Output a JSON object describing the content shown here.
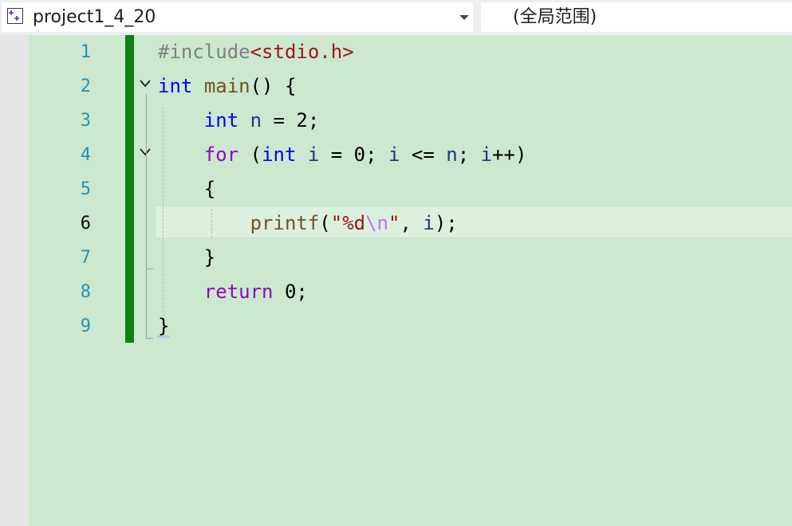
{
  "nav": {
    "project_combo": "project1_4_20",
    "scope_combo": "(全局范围)"
  },
  "editor": {
    "current_line": 6,
    "lines": [
      {
        "num": "1"
      },
      {
        "num": "2"
      },
      {
        "num": "3"
      },
      {
        "num": "4"
      },
      {
        "num": "5"
      },
      {
        "num": "6"
      },
      {
        "num": "7"
      },
      {
        "num": "8"
      },
      {
        "num": "9"
      }
    ],
    "tokens": {
      "l1_directive": "#include",
      "l1_header": "<stdio.h>",
      "l2_int": "int",
      "l2_main": "main",
      "l2_rest": "() {",
      "l3_int": "int",
      "l3_n": "n",
      "l3_rest": " = 2;",
      "l4_for": "for",
      "l4_paren": " (",
      "l4_int": "int",
      "l4_i1": "i",
      "l4_eq": " = 0; ",
      "l4_i2": "i",
      "l4_le": " <= ",
      "l4_n": "n",
      "l4_semi": "; ",
      "l4_i3": "i",
      "l4_end": "++)",
      "l5_brace": "{",
      "l6_printf": "printf",
      "l6_open": "(",
      "l6_str1": "\"%d",
      "l6_esc": "\\n",
      "l6_str2": "\"",
      "l6_comma": ", ",
      "l6_i": "i",
      "l6_close": ");",
      "l7_brace": "}",
      "l8_return": "return",
      "l8_rest": " 0;",
      "l9_brace": "}"
    }
  },
  "colors": {
    "editor_background": "#cce8cf",
    "change_marker": "#108010",
    "keyword": "#0000ff",
    "control_keyword": "#8f08c4",
    "function": "#74531f",
    "variable": "#1f377f",
    "string": "#a31515",
    "escape": "#b776fb",
    "preprocessor": "#808080"
  },
  "icons": {
    "project_icon": "cpp-project-icon",
    "dropdown": "chevron-down-icon",
    "fold": "fold-chevron-icon"
  }
}
